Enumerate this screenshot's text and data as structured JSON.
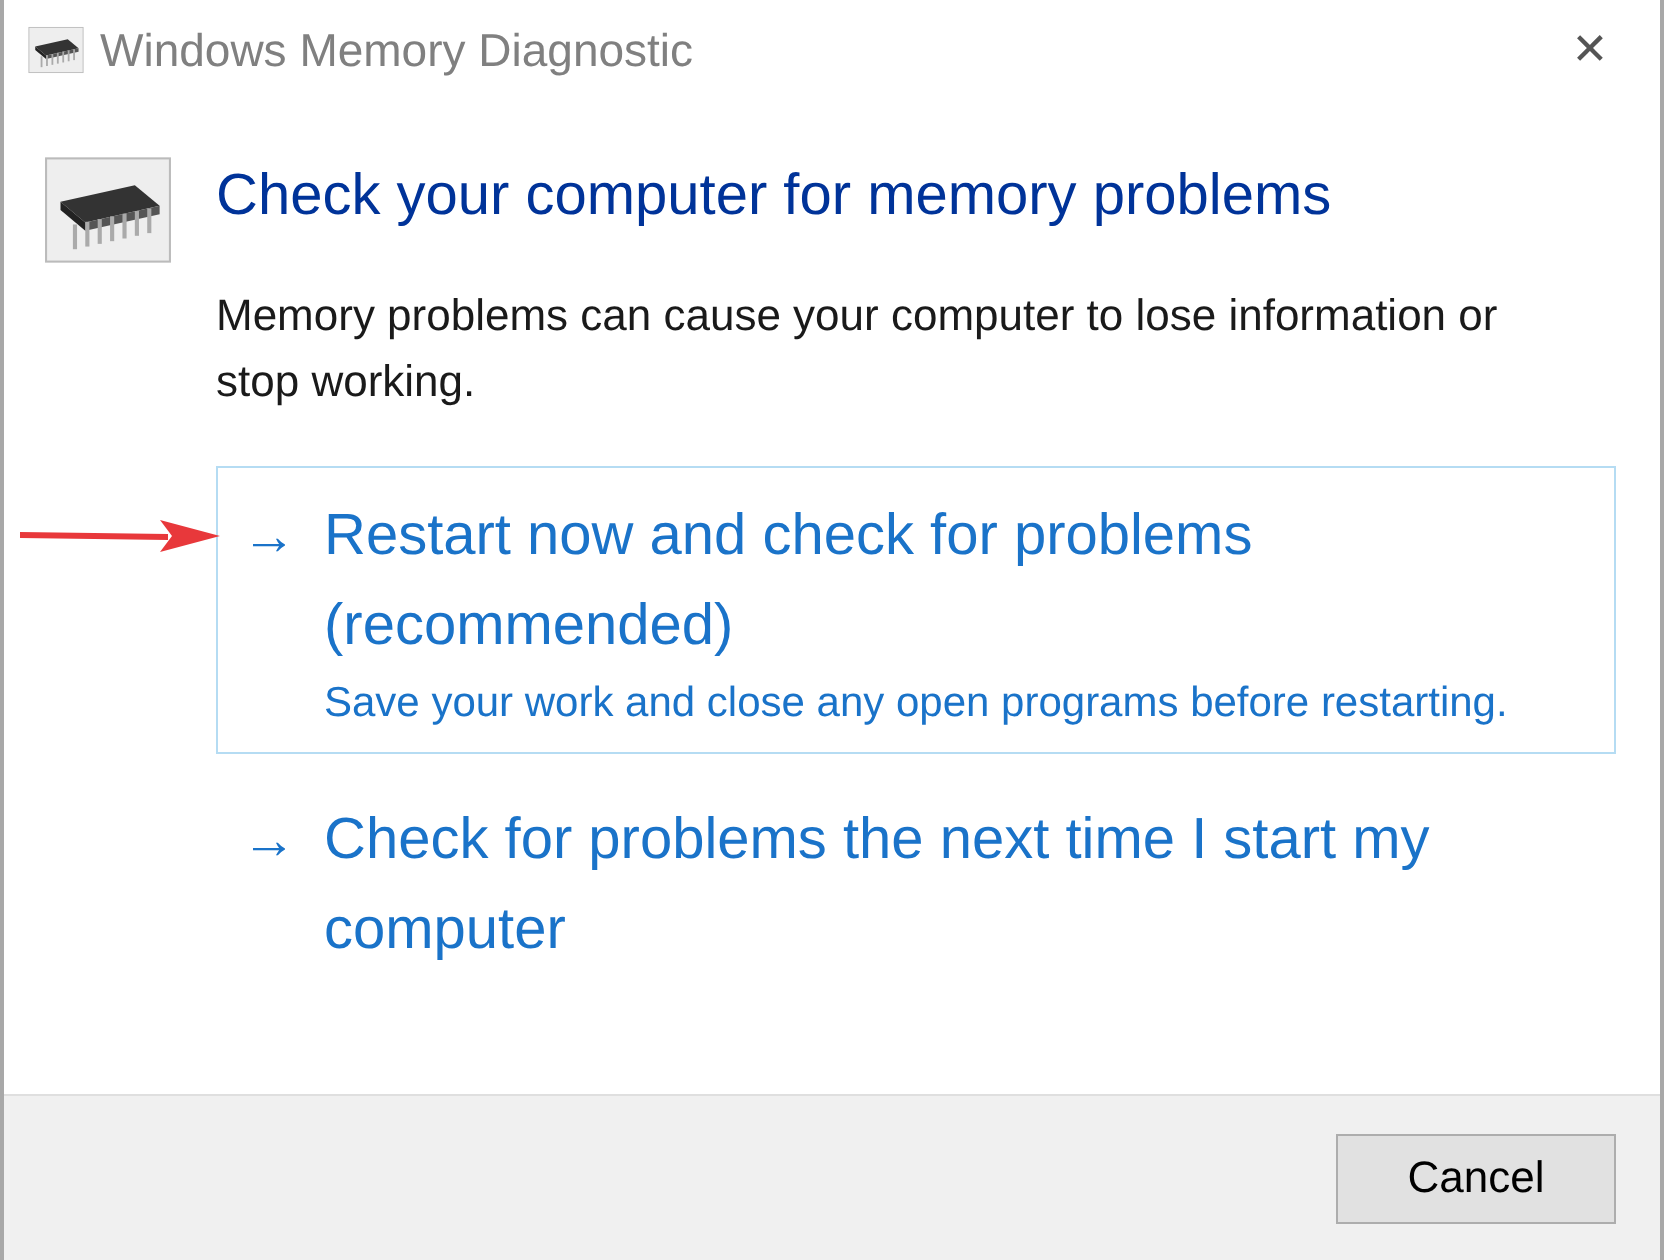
{
  "window": {
    "title": "Windows Memory Diagnostic",
    "close": "✕"
  },
  "heading": "Check your computer for memory problems",
  "description": "Memory problems can cause your computer to lose information or stop working.",
  "options": [
    {
      "arrow": "→",
      "title": "Restart now and check for problems (recommended)",
      "subtitle": "Save your work and close any open programs before restarting.",
      "selected": true
    },
    {
      "arrow": "→",
      "title": "Check for problems the next time I start my computer",
      "selected": false
    }
  ],
  "buttons": [
    "Cancel"
  ]
}
